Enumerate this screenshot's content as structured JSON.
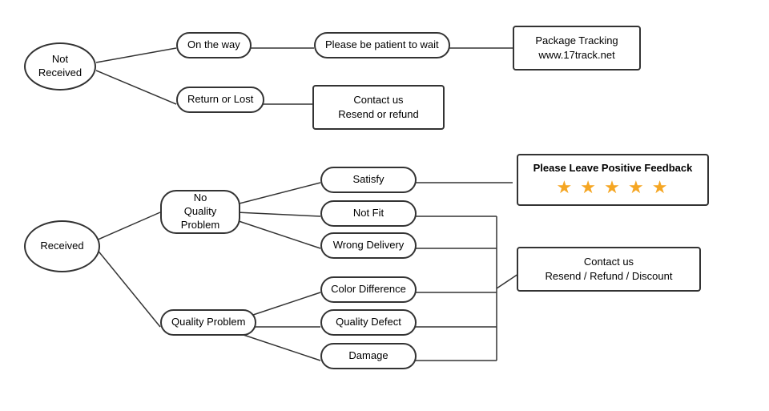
{
  "nodes": {
    "not_received": {
      "label": "Not\nReceived"
    },
    "on_the_way": {
      "label": "On the way"
    },
    "return_or_lost": {
      "label": "Return or Lost"
    },
    "patient_wait": {
      "label": "Please be patient to wait"
    },
    "package_tracking": {
      "label": "Package Tracking\nwww.17track.net"
    },
    "contact_resend_refund": {
      "label": "Contact us\nResend or refund"
    },
    "received": {
      "label": "Received"
    },
    "no_quality_problem": {
      "label": "No\nQuality Problem"
    },
    "quality_problem": {
      "label": "Quality Problem"
    },
    "satisfy": {
      "label": "Satisfy"
    },
    "not_fit": {
      "label": "Not Fit"
    },
    "wrong_delivery": {
      "label": "Wrong Delivery"
    },
    "color_difference": {
      "label": "Color Difference"
    },
    "quality_defect": {
      "label": "Quality Defect"
    },
    "damage": {
      "label": "Damage"
    },
    "please_leave_feedback": {
      "label": "Please Leave Positive Feedback"
    },
    "stars": {
      "label": "★ ★ ★ ★ ★"
    },
    "contact_resend_refund_discount": {
      "label": "Contact us\nResend / Refund / Discount"
    }
  }
}
